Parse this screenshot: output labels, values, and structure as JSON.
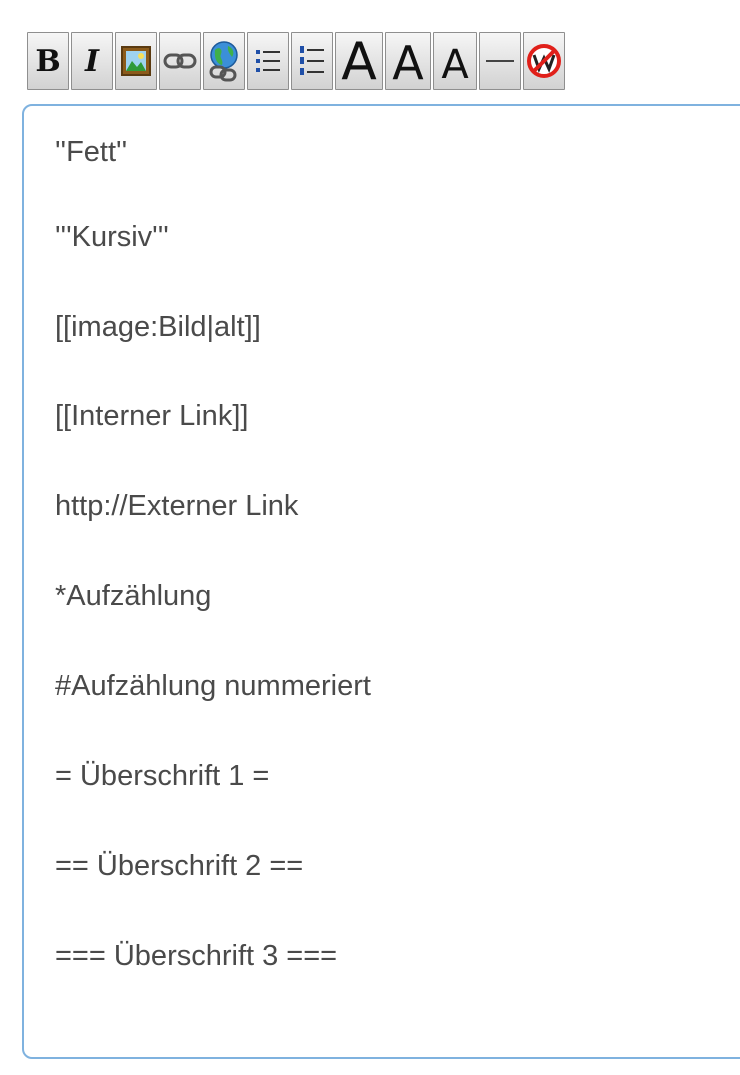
{
  "toolbar": {
    "buttons": [
      {
        "name": "bold",
        "glyph": "B"
      },
      {
        "name": "italic",
        "glyph": "I"
      },
      {
        "name": "image",
        "icon": "image-icon"
      },
      {
        "name": "internal-link",
        "icon": "chain-link-icon"
      },
      {
        "name": "external-link",
        "icon": "globe-link-icon"
      },
      {
        "name": "bullet-list",
        "icon": "bullet-list-icon"
      },
      {
        "name": "numbered-list",
        "icon": "numbered-list-icon"
      },
      {
        "name": "heading-1",
        "glyph": "A"
      },
      {
        "name": "heading-2",
        "glyph": "A"
      },
      {
        "name": "heading-3",
        "glyph": "A"
      },
      {
        "name": "horizontal-rule",
        "icon": "horizontal-rule-icon"
      },
      {
        "name": "no-wiki",
        "icon": "no-wiki-icon"
      }
    ]
  },
  "editor": {
    "lines": [
      "''Fett''",
      "'''Kursiv'''",
      "[[image:Bild|alt]]",
      "[[Interner Link]]",
      "http://Externer Link",
      "*Aufzählung",
      "#Aufzählung nummeriert",
      "= Überschrift 1 =",
      "== Überschrift 2 ==",
      "=== Überschrift 3 ==="
    ]
  },
  "colors": {
    "editor_border": "#7fb2df",
    "text": "#4a4a4a"
  }
}
